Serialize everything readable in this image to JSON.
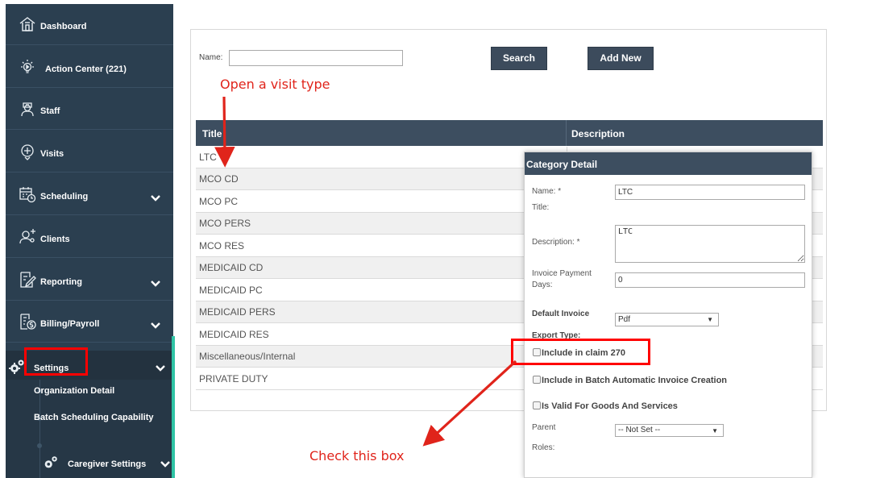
{
  "sidebar": {
    "items": [
      {
        "label": "Dashboard",
        "icon": "home-icon"
      },
      {
        "label": "Action Center (221)",
        "icon": "lightbulb-icon"
      },
      {
        "label": "Staff",
        "icon": "staff-icon"
      },
      {
        "label": "Visits",
        "icon": "visit-icon"
      },
      {
        "label": "Scheduling",
        "icon": "calendar-clock-icon"
      },
      {
        "label": "Clients",
        "icon": "clients-icon"
      },
      {
        "label": "Reporting",
        "icon": "report-edit-icon"
      },
      {
        "label": "Billing/Payroll",
        "icon": "billing-icon"
      },
      {
        "label": "Settings",
        "icon": "gears-icon"
      }
    ],
    "sub_items": [
      "Organization Detail",
      "Batch Scheduling Capability",
      "Caregiver Settings"
    ]
  },
  "search": {
    "name_label": "Name:",
    "name_value": "",
    "search_button": "Search",
    "add_button": "Add New"
  },
  "table": {
    "headers": [
      "Title",
      "Description"
    ],
    "rows": [
      "LTC",
      "MCO CD",
      "MCO PC",
      "MCO PERS",
      "MCO RES",
      "MEDICAID CD",
      "MEDICAID PC",
      "MEDICAID PERS",
      "MEDICAID RES",
      "Miscellaneous/Internal",
      "PRIVATE DUTY"
    ]
  },
  "category_detail": {
    "title": "Category Detail",
    "name_label": "Name: *",
    "name_value": "LTC",
    "title_label": "Title:",
    "description_label": "Description: *",
    "description_value": "LTC",
    "invoice_days_label": "Invoice Payment Days:",
    "invoice_days_value": "0",
    "export_type_label": "Default Invoice Export Type:",
    "export_type_value": "Pdf",
    "checkboxes": [
      {
        "label": "Include in claim 270",
        "checked": false
      },
      {
        "label": "Include in Batch Automatic Invoice Creation",
        "checked": false
      },
      {
        "label": "Is Valid For Goods And Services",
        "checked": false
      }
    ],
    "parent_label": "Parent",
    "parent_value": "-- Not Set --",
    "roles_label": "Roles:"
  },
  "annotations": {
    "open_visit_type": "Open a visit type",
    "check_box": "Check this box",
    "color": "#e0241b"
  },
  "colors": {
    "sidebar_bg": "#2b3f50",
    "accent": "#2fc4a5",
    "header_bg": "#3d4e60"
  }
}
